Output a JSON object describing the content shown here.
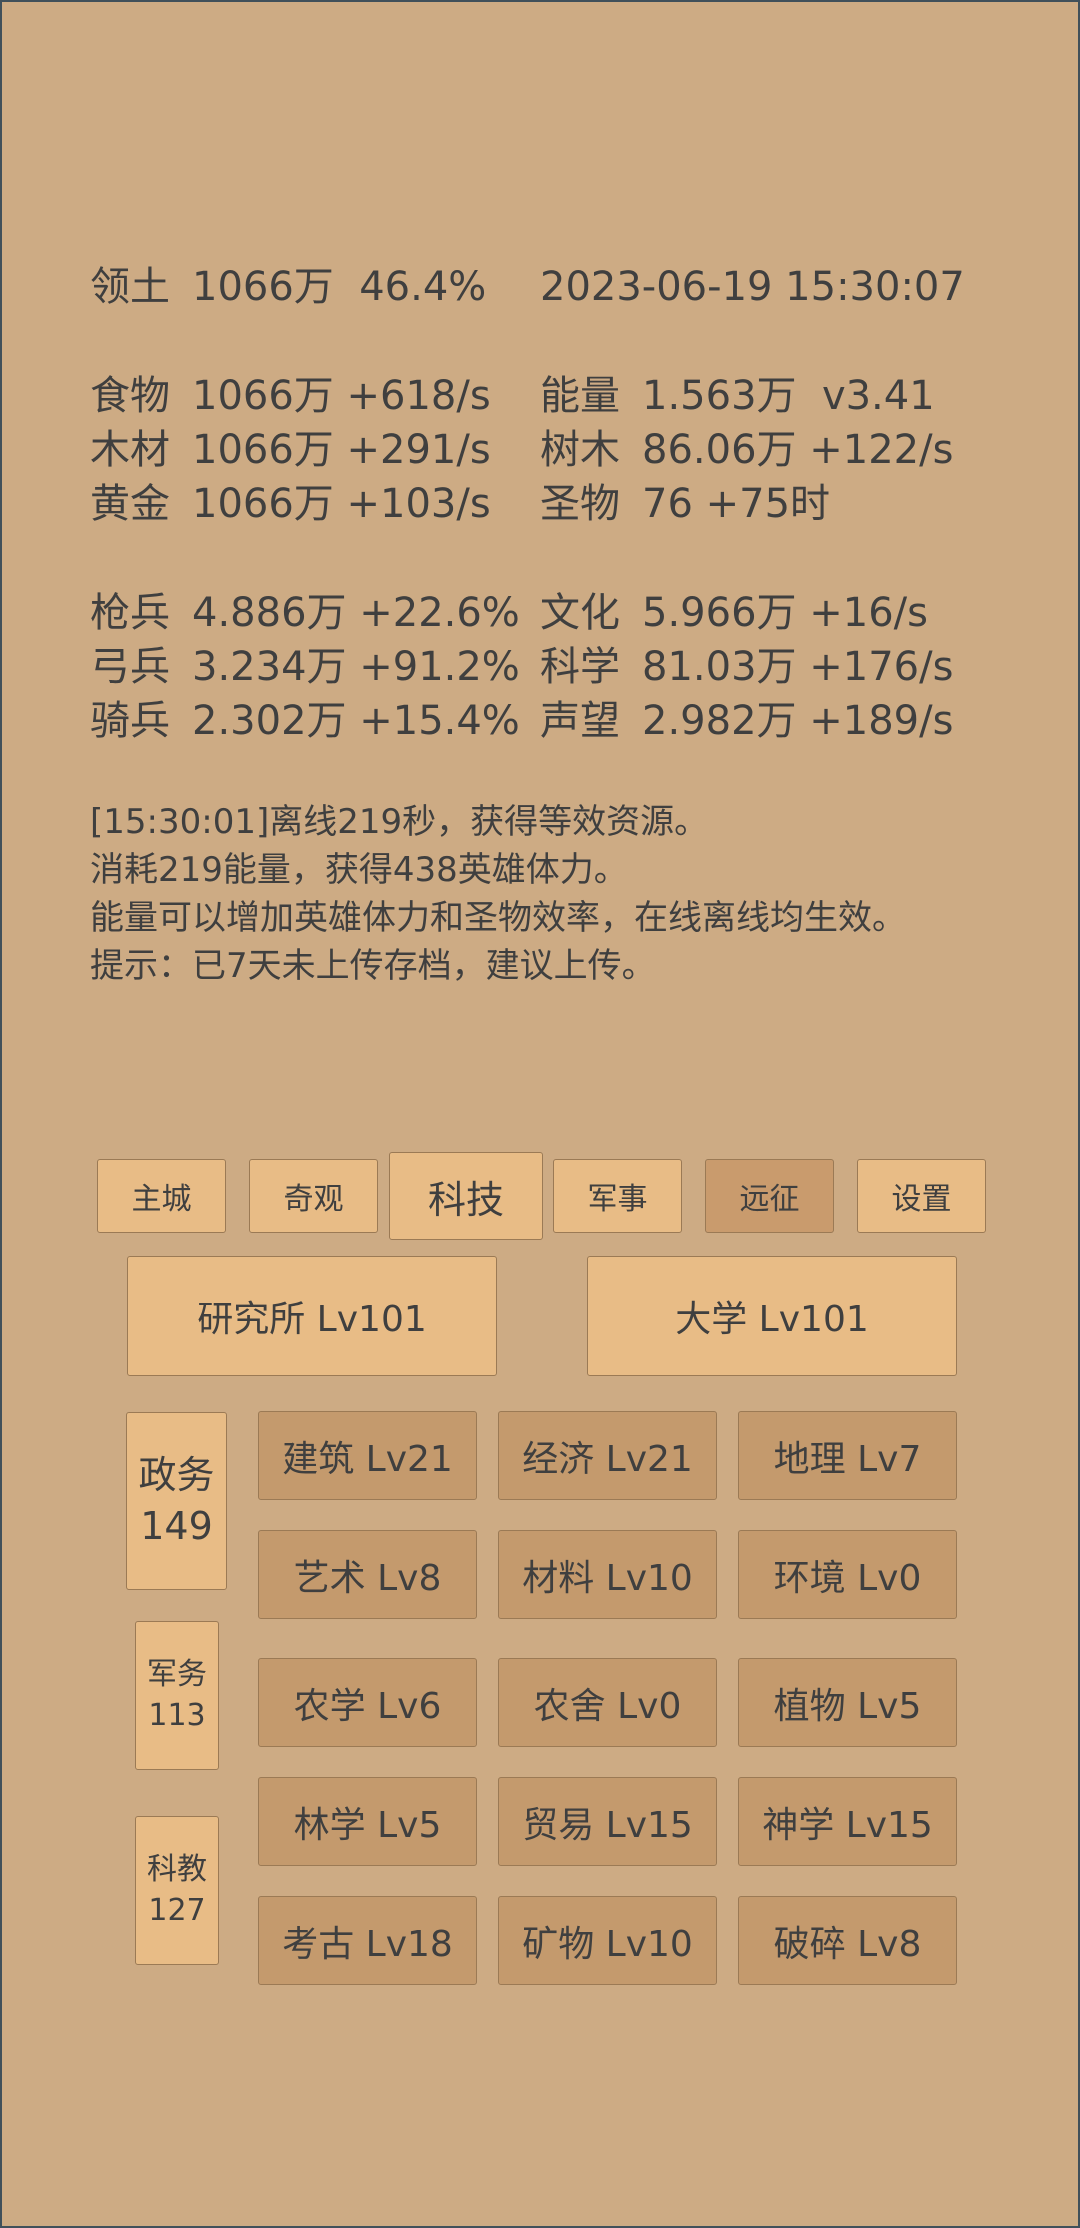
{
  "status": {
    "territory_label": "领土",
    "territory_value": "1066万  46.4%",
    "datetime": "2023-06-19 15:30:07"
  },
  "resources": {
    "food": {
      "label": "食物",
      "value": "1066万 +618/s"
    },
    "energy": {
      "label": "能量",
      "value": "1.563万  v3.41"
    },
    "wood": {
      "label": "木材",
      "value": "1066万 +291/s"
    },
    "trees": {
      "label": "树木",
      "value": "86.06万 +122/s"
    },
    "gold": {
      "label": "黄金",
      "value": "1066万 +103/s"
    },
    "relic": {
      "label": "圣物",
      "value": "76 +75时"
    }
  },
  "army": {
    "spearman": {
      "label": "枪兵",
      "value": "4.886万 +22.6%"
    },
    "archer": {
      "label": "弓兵",
      "value": "3.234万 +91.2%"
    },
    "cavalry": {
      "label": "骑兵",
      "value": "2.302万 +15.4%"
    }
  },
  "culture": {
    "culture": {
      "label": "文化",
      "value": "5.966万 +16/s"
    },
    "science": {
      "label": "科学",
      "value": "81.03万 +176/s"
    },
    "prestige": {
      "label": "声望",
      "value": "2.982万 +189/s"
    }
  },
  "messages": [
    "[15:30:01]离线219秒，获得等效资源。",
    "消耗219能量，获得438英雄体力。",
    "能量可以增加英雄体力和圣物效率，在线离线均生效。",
    "提示：已7天未上传存档，建议上传。"
  ],
  "tabs": {
    "main_city": "主城",
    "wonders": "奇观",
    "tech": "科技",
    "military": "军事",
    "expedition": "远征",
    "settings": "设置"
  },
  "buildings": {
    "institute": "研究所 Lv101",
    "university": "大学 Lv101"
  },
  "categories": {
    "politics": {
      "name": "政务",
      "count": "149"
    },
    "military": {
      "name": "军务",
      "count": "113"
    },
    "education": {
      "name": "科教",
      "count": "127"
    }
  },
  "techs": [
    "建筑 Lv21",
    "经济 Lv21",
    "地理 Lv7",
    "艺术 Lv8",
    "材料 Lv10",
    "环境 Lv0",
    "农学 Lv6",
    "农舍 Lv0",
    "植物 Lv5",
    "林学 Lv5",
    "贸易 Lv15",
    "神学 Lv15",
    "考古 Lv18",
    "矿物 Lv10",
    "破碎 Lv8"
  ]
}
